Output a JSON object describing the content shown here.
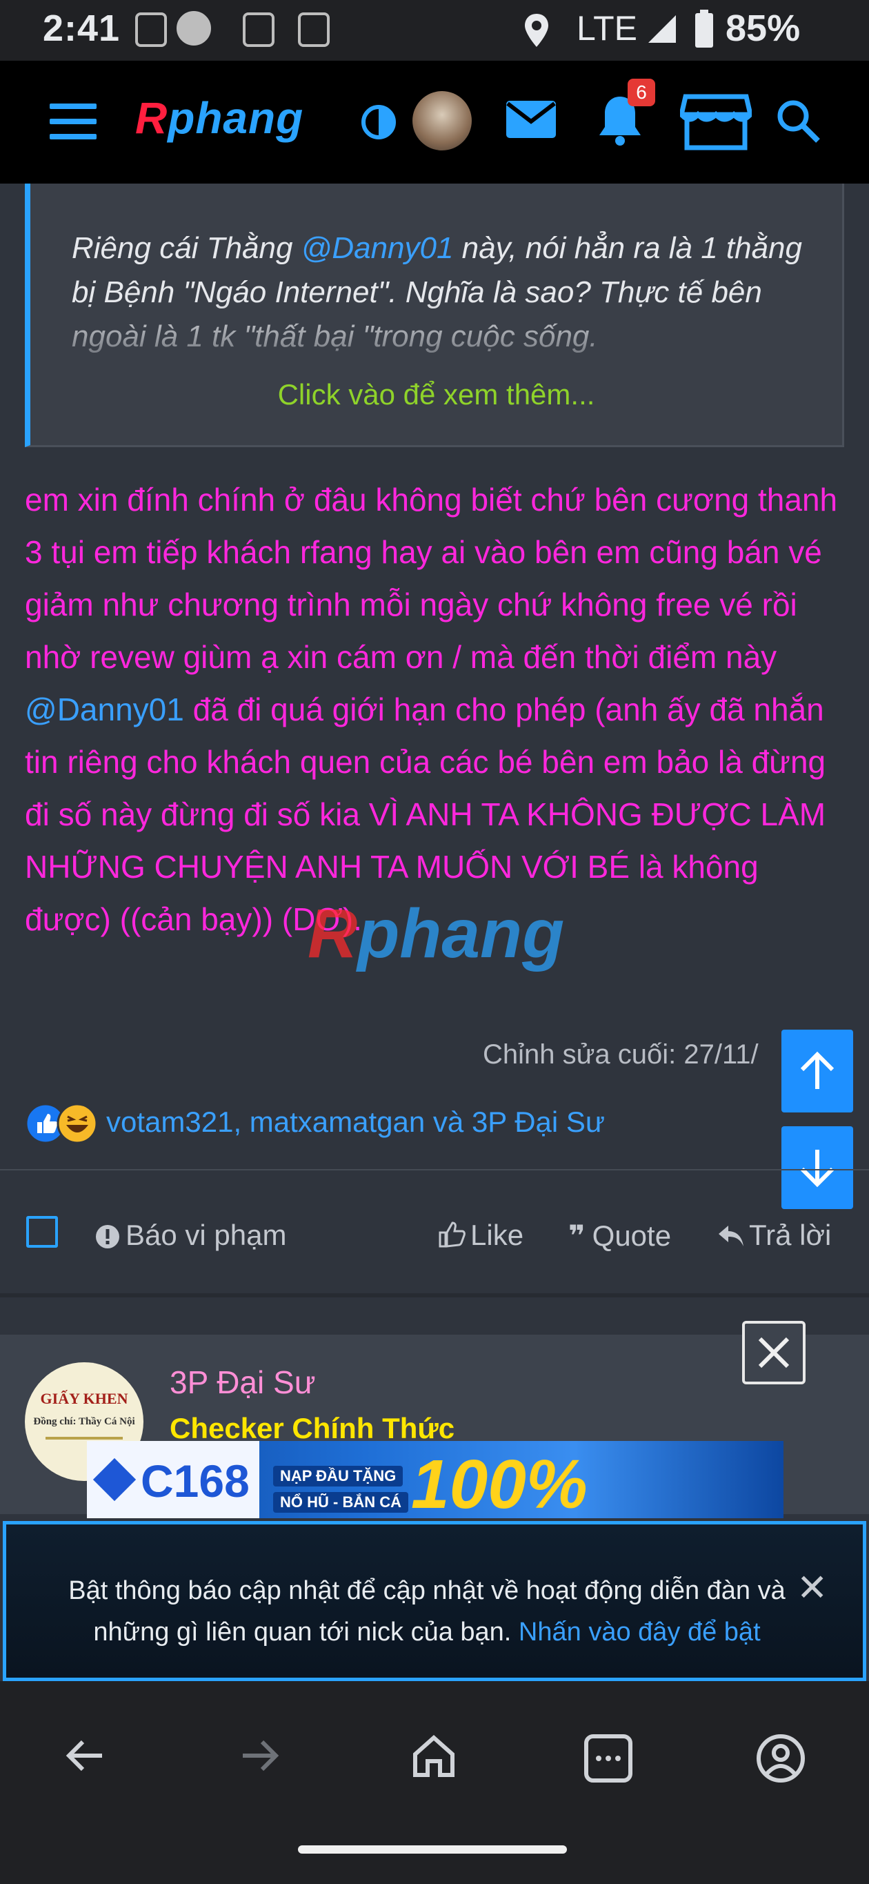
{
  "status_bar": {
    "time": "2:41",
    "network": "LTE",
    "battery": "85%"
  },
  "header": {
    "logo_r": "R",
    "logo_rest": "phang",
    "notification_count": "6"
  },
  "quote": {
    "text_before": "Riêng cái Thằng ",
    "mention": "@Danny01",
    "text_after": " này, nói hẳn ra là 1 thằng bị Bệnh \"Ngáo Internet\". Nghĩa là sao? Thực tế bên ngoài là 1 tk \"thất bại \"trong cuộc sống.",
    "expand_label": "Click vào để xem thêm..."
  },
  "post": {
    "text_before": "em xin đính chính ở đâu không biết chứ bên cương thanh 3 tụi em tiếp khách rfang hay ai vào bên em cũng bán vé giảm như chương trình mỗi ngày chứ không free vé rồi nhờ revew giùm ạ xin cám ơn / mà đến thời điểm này ",
    "mention": "@Danny01",
    "text_after": " đã đi quá giới hạn cho phép (anh ấy đã nhắn tin riêng cho khách quen của các bé bên em bảo là đừng đi số này đừng đi số kia VÌ ANH TA KHÔNG ĐƯỢC LÀM NHỮNG CHUYỆN ANH TA MUỐN VỚI BÉ là không được) ((cản bạy)) (DƠ).",
    "edited": "Chỉnh sửa cuối: 27/11/",
    "reactions_text": "votam321, matxamatgan và 3P Đại Sư"
  },
  "actions": {
    "report": "Báo vi phạm",
    "like": "Like",
    "quote": "Quote",
    "reply": "Trả lời"
  },
  "next_post": {
    "author": "3P Đại Sư",
    "role": "Checker Chính Thức",
    "avatar_title": "GIẤY KHEN",
    "avatar_line": "Đồng chí: Thầy Cá Nội"
  },
  "banner": {
    "brand": "C168",
    "tag1": "NẠP ĐẦU TẶNG",
    "tag2": "NỔ HŨ - BẮN CÁ",
    "big": "100%"
  },
  "notification_bar": {
    "text": "Bật thông báo cập nhật để cập nhật về hoạt động diễn đàn và những gì liên quan tới nick của bạn. ",
    "link": "Nhấn vào đây để bật"
  },
  "colors": {
    "accent": "#2aa3ff",
    "post_text": "#ff27dd",
    "quote_more": "#8fd32a",
    "role": "#ffe600"
  }
}
